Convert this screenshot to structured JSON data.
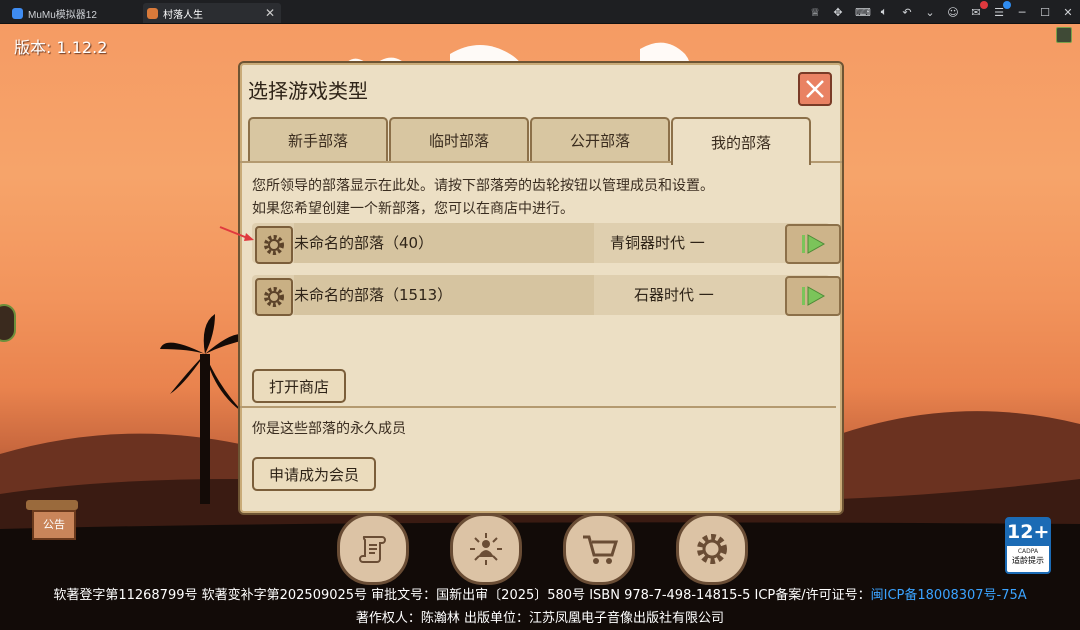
{
  "window": {
    "tabs": [
      {
        "label": "MuMu模拟器12"
      },
      {
        "label": "村落人生"
      }
    ]
  },
  "game": {
    "version": "版本: 1.12.2"
  },
  "dialog": {
    "title": "选择游戏类型",
    "tabs": [
      {
        "label": "新手部落",
        "active": false
      },
      {
        "label": "临时部落",
        "active": false
      },
      {
        "label": "公开部落",
        "active": false
      },
      {
        "label": "我的部落",
        "active": true
      }
    ],
    "description_line1": "您所领导的部落显示在此处。请按下部落旁的齿轮按钮以管理成员和设置。",
    "description_line2": "如果您希望创建一个新部落，您可以在商店中进行。",
    "tribes": [
      {
        "name": "未命名的部落（40）",
        "age": "青铜器时代 一"
      },
      {
        "name": "未命名的部落（1513）",
        "age": "石器时代 一"
      }
    ],
    "open_shop_label": "打开商店",
    "member_note": "你是这些部落的永久成员",
    "apply_member_label": "申请成为会员"
  },
  "bottom_bar": {
    "notice_label": "公告",
    "icons": [
      "scroll-icon",
      "meditate-icon",
      "cart-icon",
      "settings-gear-icon"
    ]
  },
  "rating": {
    "age": "12+",
    "org": "CADPA",
    "hint": "适龄提示"
  },
  "footer": {
    "line1_text": "软著登字第11268799号 软著变补字第202509025号 审批文号：国新出审〔2025〕580号 ISBN 978-7-498-14815-5 ICP备案/许可证号：",
    "icp": "闽ICP备18008307号-75A",
    "line2": "著作权人：陈瀚林 出版单位：江苏凤凰电子音像出版社有限公司"
  },
  "colors": {
    "accent_green": "#7bc45a",
    "close_red": "#e98263",
    "panel": "#ecdfc4",
    "icp_link": "#3ba3ff"
  }
}
